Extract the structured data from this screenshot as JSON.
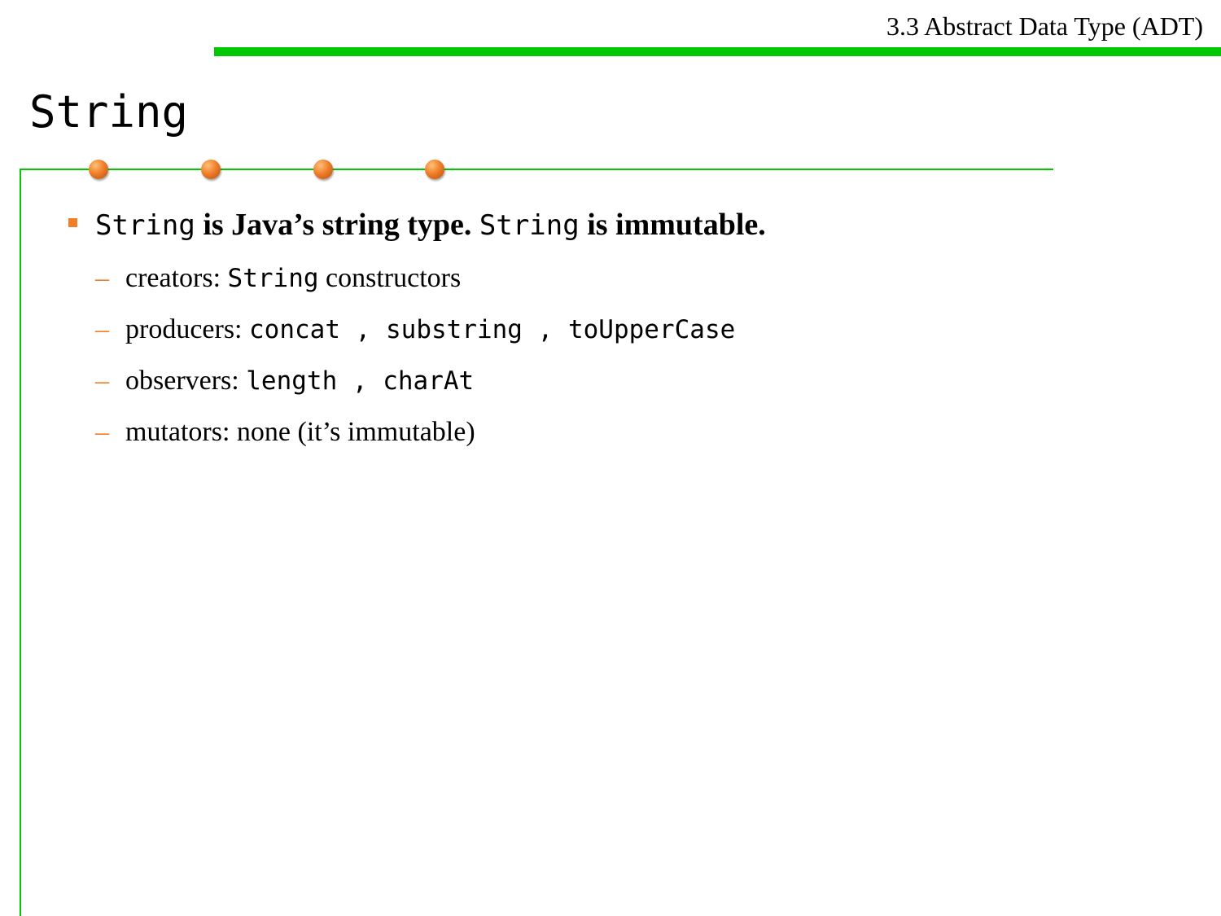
{
  "header": {
    "section_title": "3.3 Abstract Data Type (ADT)"
  },
  "slide": {
    "title": "String"
  },
  "main_bullet": {
    "code1": "String",
    "text1": " is Java’s string type. ",
    "code2": "String",
    "text2": " is immutable."
  },
  "sub_bullets": {
    "dash": "–",
    "creators": {
      "label": "creators: ",
      "code": "String",
      "rest": " constructors"
    },
    "producers": {
      "label": "producers: ",
      "code1": "concat",
      "sep1": " , ",
      "code2": "substring",
      "sep2": " , ",
      "code3": "toUpperCase"
    },
    "observers": {
      "label": "observers: ",
      "code1": "length",
      "sep1": " , ",
      "code2": "charAt"
    },
    "mutators": {
      "text": "mutators: none (it’s immutable)"
    }
  },
  "colors": {
    "accent_green": "#00c800",
    "accent_orange": "#f07f2a"
  }
}
